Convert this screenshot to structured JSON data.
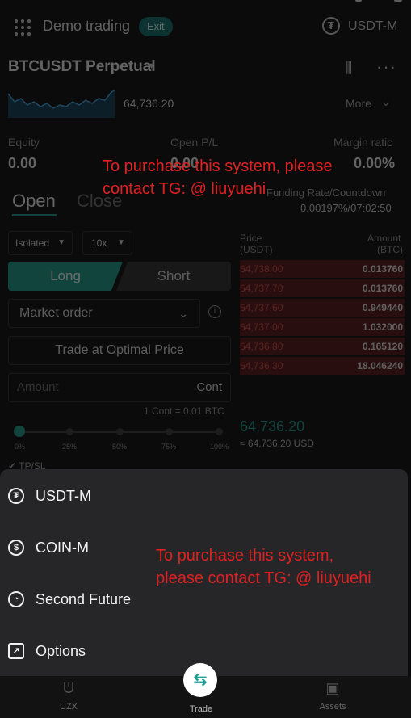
{
  "header": {
    "title": "Demo trading",
    "exit_label": "Exit",
    "market_label": "USDT-M",
    "tether_glyph": "₮"
  },
  "symbol": {
    "name": "BTCUSDT Perpetual",
    "last_price": "64,736.20",
    "more_label": "More"
  },
  "stats": {
    "equity_label": "Equity",
    "equity_value": "0.00",
    "openpl_label": "Open P/L",
    "openpl_value": "0.00",
    "margin_label": "Margin ratio",
    "margin_value": "0.00%",
    "funding_label": "Funding Rate/Countdown",
    "funding_value": "0.00197%/07:02:50"
  },
  "tabs": {
    "open": "Open",
    "close": "Close"
  },
  "form": {
    "margin_mode": "Isolated",
    "leverage": "10x",
    "long_label": "Long",
    "short_label": "Short",
    "order_type": "Market order",
    "optimal_label": "Trade at Optimal Price",
    "amount_placeholder": "Amount",
    "amount_unit": "Cont",
    "cont_note": "1 Cont = 0.01 BTC",
    "slider_value_percent": 0,
    "slider_ticks": [
      "0%",
      "25%",
      "50%",
      "75%",
      "100%"
    ],
    "tpsl_label": "TP/SL"
  },
  "orderbook": {
    "price_header": "Price",
    "price_unit": "(USDT)",
    "amount_header": "Amount",
    "amount_unit": "(BTC)",
    "asks": [
      {
        "price": "64,738.00",
        "amount": "0.013760"
      },
      {
        "price": "64,737.70",
        "amount": "0.013760"
      },
      {
        "price": "64,737.60",
        "amount": "0.949440"
      },
      {
        "price": "64,737.00",
        "amount": "1.032000"
      },
      {
        "price": "64,736.80",
        "amount": "0.165120"
      },
      {
        "price": "64,736.30",
        "amount": "18.046240"
      }
    ],
    "mark_price": "64,736.20",
    "mark_usd": "≈ 64,736.20 USD"
  },
  "watermark": {
    "text_top_line1": "To purchase this system, please",
    "text_top_line2": "contact TG: @ liuyuehi",
    "text_bottom_line1": "To purchase this system,",
    "text_bottom_line2": "please contact TG: @ liuyuehi"
  },
  "sheet": {
    "items": [
      {
        "label": "USDT-M",
        "icon": "tether-icon",
        "glyph": "₮"
      },
      {
        "label": "COIN-M",
        "icon": "dollar-coin-icon",
        "glyph": "$"
      },
      {
        "label": "Second Future",
        "icon": "stopwatch-icon",
        "glyph": "◔"
      },
      {
        "label": "Options",
        "icon": "options-box-icon",
        "glyph": "↗"
      }
    ]
  },
  "nav": {
    "items": [
      {
        "label": "UZX",
        "icon": "uzx-logo-icon"
      },
      {
        "label": "Trade",
        "icon": "trade-swap-icon"
      },
      {
        "label": "Assets",
        "icon": "wallet-bag-icon"
      }
    ]
  },
  "colors": {
    "accent": "#26a38f",
    "ask_red": "#e05050",
    "watermark": "#e02020",
    "exit_badge": "#1d7a78"
  }
}
